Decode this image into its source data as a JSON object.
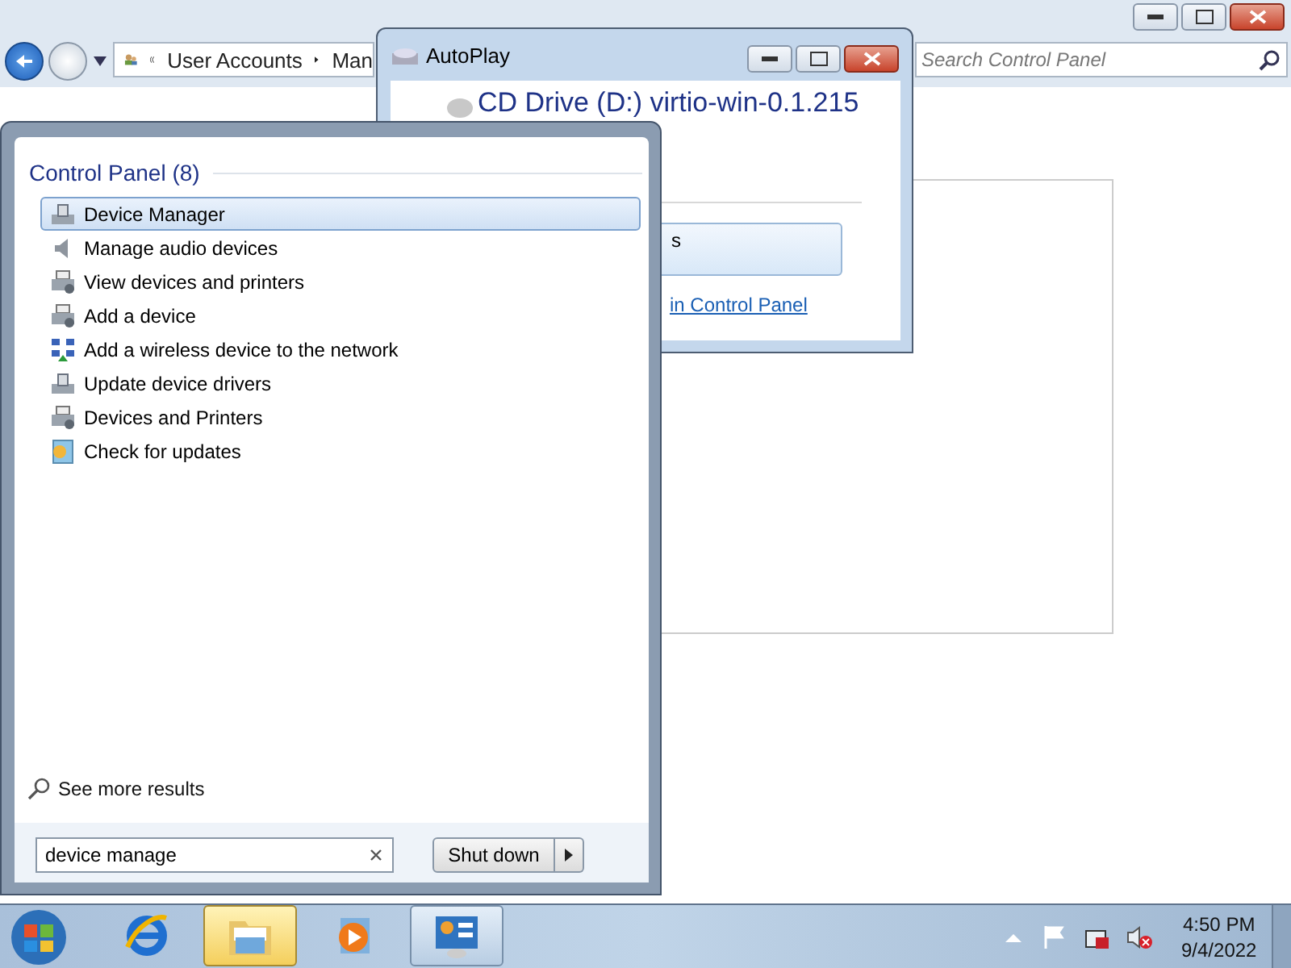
{
  "background_window": {
    "breadcrumb": [
      "User Accounts",
      "Man"
    ],
    "search": {
      "placeholder": "Search Control Panel"
    }
  },
  "autoplay": {
    "title": "AutoPlay",
    "drive": "CD Drive (D:) virtio-win-0.1.215",
    "option": "s",
    "link": "in Control Panel"
  },
  "start_menu": {
    "group": {
      "title": "Control Panel (8)",
      "items": [
        {
          "label": "Device Manager",
          "kind": "device",
          "selected": true
        },
        {
          "label": "Manage audio devices",
          "kind": "speaker",
          "selected": false
        },
        {
          "label": "View devices and printers",
          "kind": "printer",
          "selected": false
        },
        {
          "label": "Add a device",
          "kind": "printer",
          "selected": false
        },
        {
          "label": "Add a wireless device to the network",
          "kind": "wireless",
          "selected": false
        },
        {
          "label": "Update device drivers",
          "kind": "device",
          "selected": false
        },
        {
          "label": "Devices and Printers",
          "kind": "printer",
          "selected": false
        },
        {
          "label": "Check for updates",
          "kind": "update",
          "selected": false
        }
      ]
    },
    "more_results": "See more results",
    "search": {
      "value": "device manage"
    },
    "shutdown": {
      "label": "Shut down"
    }
  },
  "taskbar": {
    "apps": [
      {
        "kind": "browser",
        "open": false,
        "selected": false
      },
      {
        "kind": "folder",
        "open": true,
        "selected": true
      },
      {
        "kind": "media",
        "open": false,
        "selected": false
      },
      {
        "kind": "panel",
        "open": true,
        "selected": false
      }
    ],
    "tray": {
      "time": "4:50 PM",
      "date": "9/4/2022"
    }
  }
}
